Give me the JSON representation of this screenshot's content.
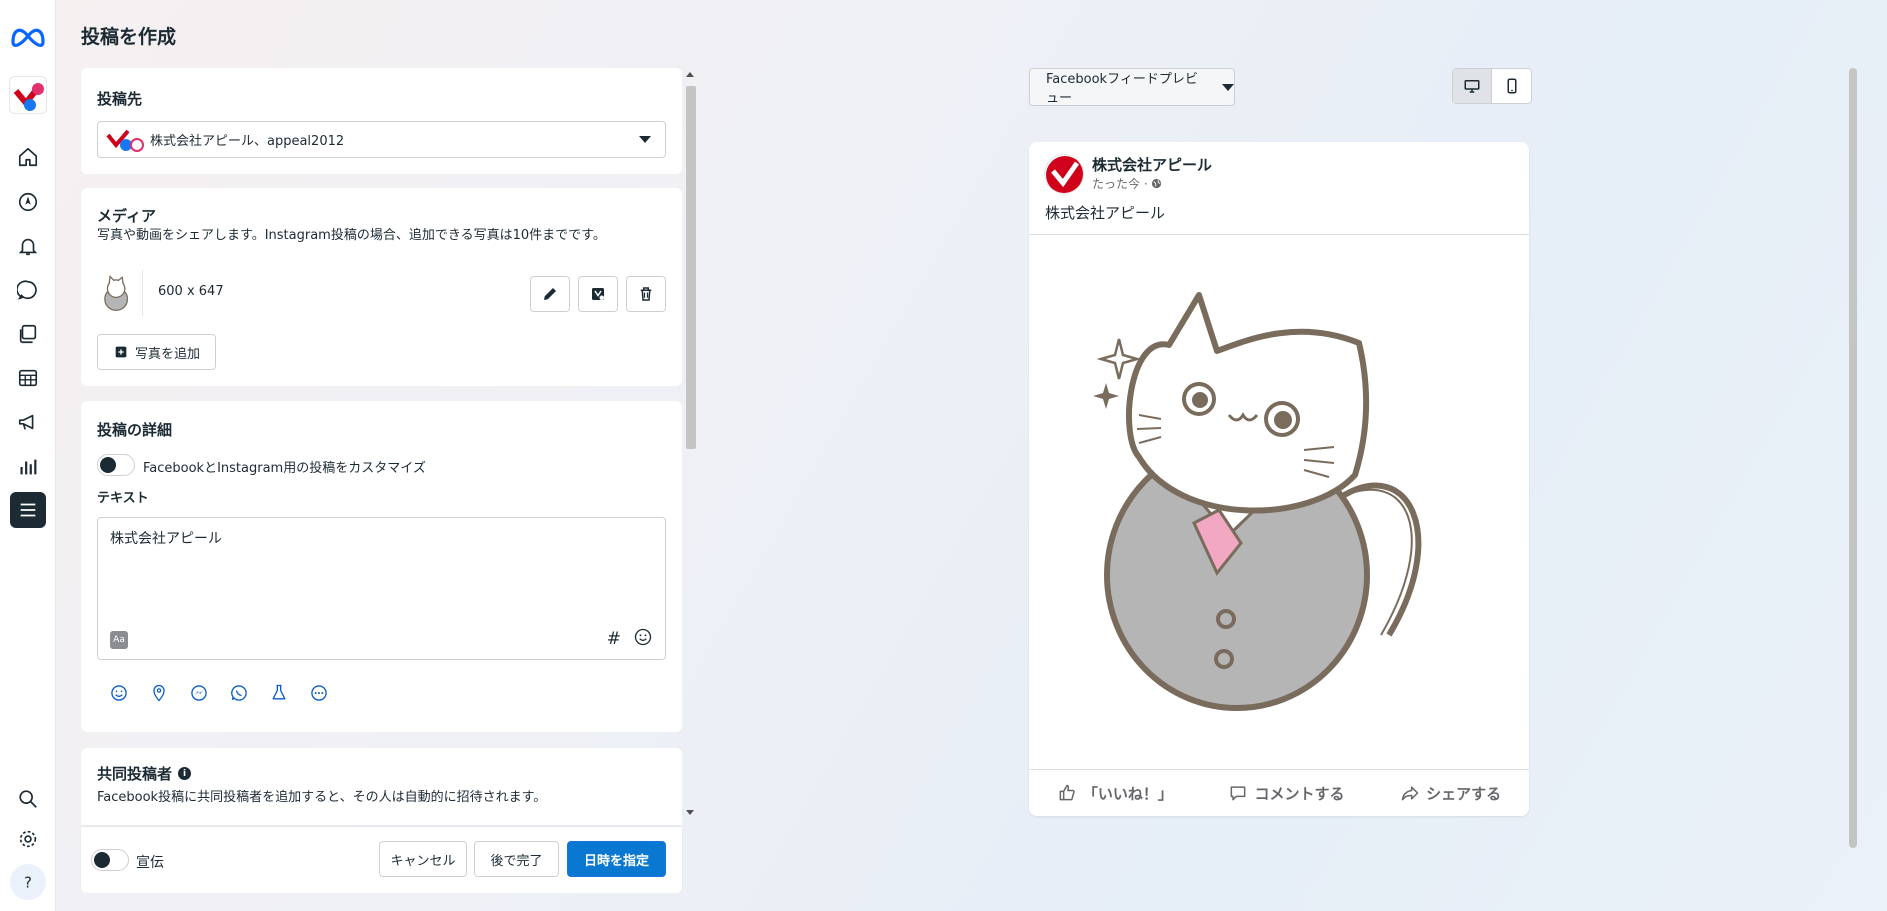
{
  "page": {
    "title": "投稿を作成"
  },
  "nav": {
    "items": [
      "home",
      "explore",
      "notifications",
      "messages",
      "content",
      "planner",
      "ads",
      "insights",
      "menu"
    ],
    "bottom": [
      "search",
      "settings",
      "help"
    ]
  },
  "destination": {
    "heading": "投稿先",
    "selected": "株式会社アピール、appeal2012"
  },
  "media": {
    "heading": "メディア",
    "description": "写真や動画をシェアします。Instagram投稿の場合、追加できる写真は10件までです。",
    "item_size": "600 x 647",
    "add_photo_label": "写真を追加"
  },
  "details": {
    "heading": "投稿の詳細",
    "customize_label": "FacebookとInstagram用の投稿をカスタマイズ",
    "text_label": "テキスト",
    "text_value": "株式会社アピール",
    "hashtag": "#"
  },
  "collab": {
    "heading": "共同投稿者",
    "description": "Facebook投稿に共同投稿者を追加すると、その人は自動的に招待されます。"
  },
  "footer": {
    "boost_label": "宣伝",
    "cancel_label": "キャンセル",
    "later_label": "後で完了",
    "schedule_label": "日時を指定"
  },
  "preview": {
    "dropdown_label": "Facebookフィードプレビュー",
    "page_name": "株式会社アピール",
    "time_label": "たった今 · ",
    "post_text": "株式会社アピール",
    "like_label": "「いいね！」",
    "comment_label": "コメントする",
    "share_label": "シェアする"
  },
  "colors": {
    "primary": "#0a78d1",
    "dark": "#1c2b33",
    "border": "#ccd0d5",
    "brand_red": "#d0021b"
  }
}
